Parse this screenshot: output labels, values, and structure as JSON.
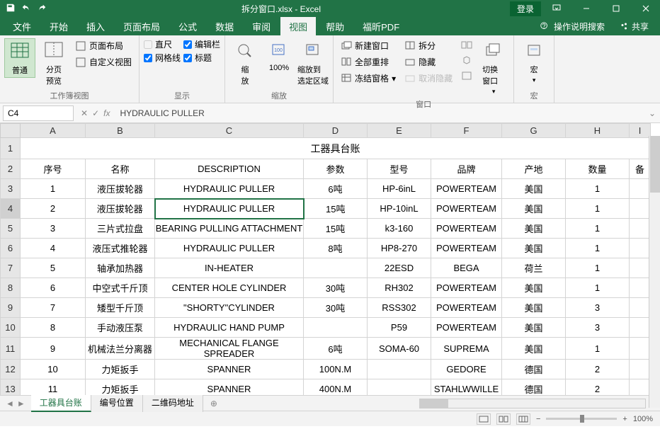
{
  "title": "拆分窗口.xlsx - Excel",
  "login": "登录",
  "menutabs": [
    "文件",
    "开始",
    "插入",
    "页面布局",
    "公式",
    "数据",
    "审阅",
    "视图",
    "帮助",
    "福昕PDF"
  ],
  "active_tab": 7,
  "help_search": "操作说明搜索",
  "share": "共享",
  "ribbon": {
    "views": {
      "normal": "普通",
      "pagebreak": "分页\n预览",
      "layout": "页面布局",
      "custom": "自定义视图",
      "group": "工作簿视图"
    },
    "show": {
      "ruler": "直尺",
      "formula": "编辑栏",
      "grid": "网格线",
      "heading": "标题",
      "group": "显示"
    },
    "zoom": {
      "zoom": "缩\n放",
      "z100": "100%",
      "zoomsel": "缩放到\n选定区域",
      "group": "缩放"
    },
    "window": {
      "neww": "新建窗口",
      "arrange": "全部重排",
      "freeze": "冻结窗格",
      "split": "拆分",
      "hide": "隐藏",
      "unhide": "取消隐藏",
      "switch": "切换窗口",
      "group": "窗口"
    },
    "macro": {
      "macro": "宏",
      "group": "宏"
    }
  },
  "namebox": "C4",
  "formula": "HYDRAULIC PULLER",
  "cols": [
    "A",
    "B",
    "C",
    "D",
    "E",
    "F",
    "G",
    "H",
    "I"
  ],
  "sheet_title": "工器具台账",
  "headers": [
    "序号",
    "名称",
    "DESCRIPTION",
    "参数",
    "型号",
    "品牌",
    "产地",
    "数量",
    "备"
  ],
  "rows": [
    {
      "n": "1",
      "name": "液压拔轮器",
      "desc": "HYDRAULIC PULLER",
      "param": "6吨",
      "model": "HP-6inL",
      "brand": "POWERTEAM",
      "origin": "美国",
      "qty": "1"
    },
    {
      "n": "2",
      "name": "液压拔轮器",
      "desc": "HYDRAULIC PULLER",
      "param": "15吨",
      "model": "HP-10inL",
      "brand": "POWERTEAM",
      "origin": "美国",
      "qty": "1"
    },
    {
      "n": "3",
      "name": "三片式拉盘",
      "desc": "BEARING PULLING ATTACHMENT",
      "param": "15吨",
      "model": "k3-160",
      "brand": "POWERTEAM",
      "origin": "美国",
      "qty": "1"
    },
    {
      "n": "4",
      "name": "液压式推轮器",
      "desc": "HYDRAULIC PULLER",
      "param": "8吨",
      "model": "HP8-270",
      "brand": "POWERTEAM",
      "origin": "美国",
      "qty": "1"
    },
    {
      "n": "5",
      "name": "轴承加热器",
      "desc": "IN-HEATER",
      "param": "",
      "model": "22ESD",
      "brand": "BEGA",
      "origin": "荷兰",
      "qty": "1"
    },
    {
      "n": "6",
      "name": "中空式千斤顶",
      "desc": "CENTER HOLE CYLINDER",
      "param": "30吨",
      "model": "RH302",
      "brand": "POWERTEAM",
      "origin": "美国",
      "qty": "1"
    },
    {
      "n": "7",
      "name": "矮型千斤顶",
      "desc": "\"SHORTY\"CYLINDER",
      "param": "30吨",
      "model": "RSS302",
      "brand": "POWERTEAM",
      "origin": "美国",
      "qty": "3"
    },
    {
      "n": "8",
      "name": "手动液压泵",
      "desc": "HYDRAULIC HAND PUMP",
      "param": "",
      "model": "P59",
      "brand": "POWERTEAM",
      "origin": "美国",
      "qty": "3"
    },
    {
      "n": "9",
      "name": "机械法兰分离器",
      "desc": "MECHANICAL FLANGE SPREADER",
      "param": "6吨",
      "model": "SOMA-60",
      "brand": "SUPREMA",
      "origin": "美国",
      "qty": "1"
    },
    {
      "n": "10",
      "name": "力矩扳手",
      "desc": "SPANNER",
      "param": "100N.M",
      "model": "",
      "brand": "GEDORE",
      "origin": "德国",
      "qty": "2"
    },
    {
      "n": "11",
      "name": "力矩扳手",
      "desc": "SPANNER",
      "param": "400N.M",
      "model": "",
      "brand": "STAHLWWILLE",
      "origin": "德国",
      "qty": "2"
    }
  ],
  "sheets": [
    "工器具台账",
    "编号位置",
    "二维码地址"
  ],
  "active_sheet": 0,
  "zoom": "100%",
  "chart_data": null
}
